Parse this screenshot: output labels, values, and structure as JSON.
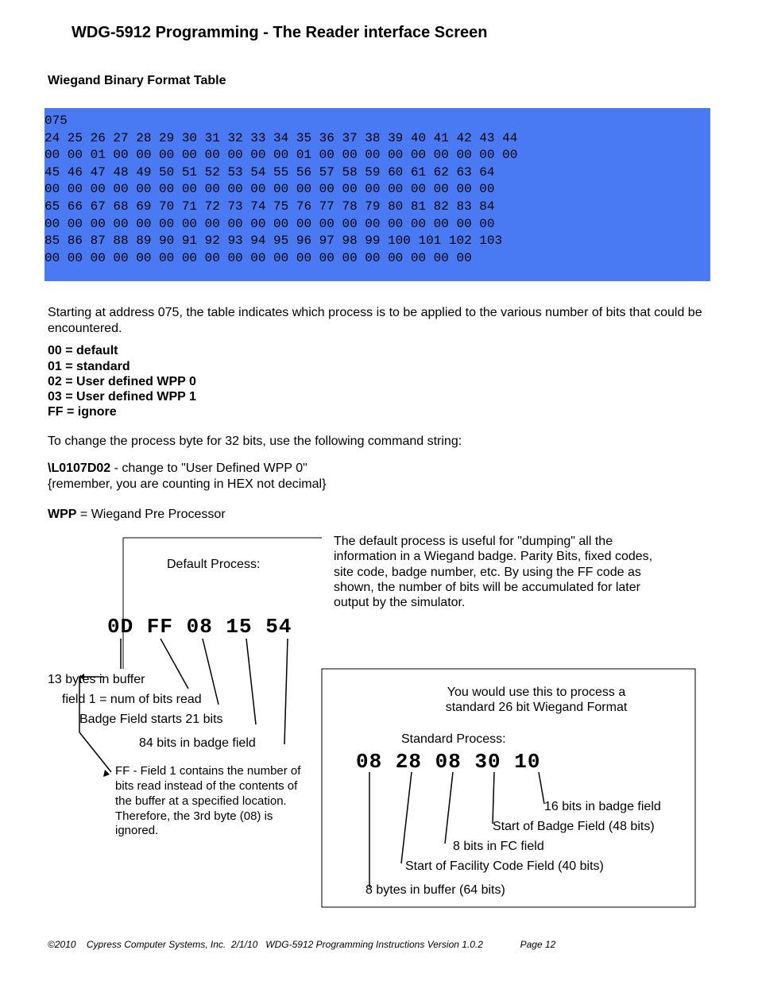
{
  "title": "WDG-5912 Programming - The Reader interface Screen",
  "subtitle": "Wiegand Binary Format Table",
  "hexdump": {
    "addr": "075",
    "lines": [
      "24 25 26 27 28 29 30 31 32 33 34 35 36 37 38 39 40 41 42 43 44",
      "00 00 01 00 00 00 00 00 00 00 00 01 00 00 00 00 00 00 00 00 00",
      "45 46 47 48 49 50 51 52 53 54 55 56 57 58 59 60 61 62 63 64",
      "00 00 00 00 00 00 00 00 00 00 00 00 00 00 00 00 00 00 00 00",
      "65 66 67 68 69 70 71 72 73 74 75 76 77 78 79 80 81 82 83 84",
      "00 00 00 00 00 00 00 00 00 00 00 00 00 00 00 00 00 00 00 00",
      "85 86 87 88 89 90 91 92 93 94 95 96 97 98 99 100 101 102 103",
      "00 00 00 00 00 00 00 00 00 00 00 00 00 00 00 00 00 00 00"
    ]
  },
  "para_intro": "Starting at address 075, the table indicates which process is to be applied to the various number of bits that could be encountered.",
  "legend": [
    "00 = default",
    "01 = standard",
    "02 = User defined WPP 0",
    "03 = User defined WPP 1",
    "FF = ignore"
  ],
  "para_change": "To change the process byte for 32 bits, use the following command string:",
  "cmd_bold": "\\L0107D02",
  "cmd_rest": " - change to \"User Defined WPP 0\"",
  "cmd_note": "{remember, you are counting in HEX not decimal}",
  "wpp_bold": "WPP",
  "wpp_rest": " = Wiegand Pre Processor",
  "diagram": {
    "default_title": "Default Process:",
    "default_bytes": "0D FF 08 15 54",
    "default_labels": {
      "l1": "13 bytes in buffer",
      "l2": "field 1 = num of bits read",
      "l3": "Badge Field starts 21 bits",
      "l4": "84 bits in badge field",
      "ff_note": "FF - Field 1 contains the number of bits read instead of the contents of the buffer at a specified location. Therefore, the 3rd byte (08) is ignored."
    },
    "right_intro": "The default process is useful for \"dumping\" all the information in a Wiegand badge. Parity Bits, fixed codes, site code, badge number, etc. By using the FF code as shown, the number of bits will be accumulated for later output by the simulator.",
    "std_box": {
      "use_text": "You would use this to process a standard 26 bit Wiegand Format",
      "std_title": "Standard Process:",
      "std_bytes": "08 28 08 30 10",
      "labels": {
        "r1": "16 bits in badge field",
        "r2": "Start of Badge Field (48 bits)",
        "r3": "8 bits in FC field",
        "r4": "Start of Facility Code Field (40 bits)",
        "r5": "8 bytes in buffer (64 bits)"
      }
    }
  },
  "footer": "©2010    Cypress Computer Systems, Inc.  2/1/10   WDG-5912 Programming Instructions Version 1.0.2              Page 12"
}
